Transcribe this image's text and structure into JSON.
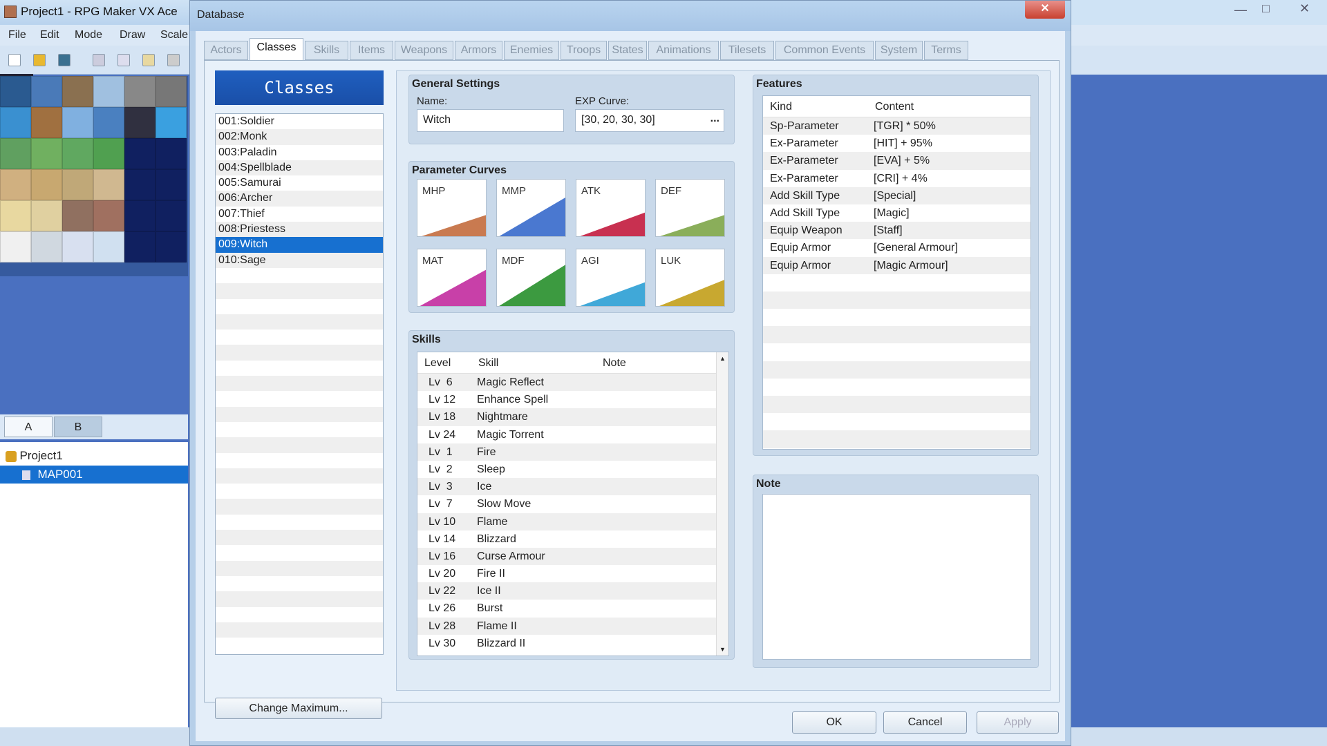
{
  "main_window": {
    "title": "Project1 - RPG Maker VX Ace",
    "menu": [
      "File",
      "Edit",
      "Mode",
      "Draw",
      "Scale"
    ],
    "layer_tabs": [
      "A",
      "B"
    ],
    "tree": {
      "project": "Project1",
      "map": "MAP001"
    }
  },
  "dialog": {
    "title": "Database",
    "tabs": [
      "Actors",
      "Classes",
      "Skills",
      "Items",
      "Weapons",
      "Armors",
      "Enemies",
      "Troops",
      "States",
      "Animations",
      "Tilesets",
      "Common Events",
      "System",
      "Terms"
    ],
    "active_tab": "Classes",
    "list_header": "Classes",
    "classes": [
      "001:Soldier",
      "002:Monk",
      "003:Paladin",
      "004:Spellblade",
      "005:Samurai",
      "006:Archer",
      "007:Thief",
      "008:Priestess",
      "009:Witch",
      "010:Sage"
    ],
    "selected_class": "009:Witch",
    "change_max": "Change Maximum...",
    "general": {
      "title": "General Settings",
      "name_label": "Name:",
      "name_value": "Witch",
      "exp_label": "EXP Curve:",
      "exp_value": "[30, 20, 30, 30]",
      "exp_button": "..."
    },
    "param_curves": {
      "title": "Parameter Curves",
      "items": [
        {
          "label": "MHP",
          "level": 0.45,
          "color": "#c97a50"
        },
        {
          "label": "MMP",
          "level": 0.8,
          "color": "#4a78d0"
        },
        {
          "label": "ATK",
          "level": 0.5,
          "color": "#c83050"
        },
        {
          "label": "DEF",
          "level": 0.45,
          "color": "#8aae5a"
        },
        {
          "label": "MAT",
          "level": 0.75,
          "color": "#c840a8"
        },
        {
          "label": "MDF",
          "level": 0.85,
          "color": "#3c9a40"
        },
        {
          "label": "AGI",
          "level": 0.5,
          "color": "#40a8d8"
        },
        {
          "label": "LUK",
          "level": 0.55,
          "color": "#c8a830"
        }
      ]
    },
    "skills": {
      "title": "Skills",
      "columns": [
        "Level",
        "Skill",
        "Note"
      ],
      "rows": [
        [
          "Lv  6",
          "Magic Reflect"
        ],
        [
          "Lv 12",
          "Enhance Spell"
        ],
        [
          "Lv 18",
          "Nightmare"
        ],
        [
          "Lv 24",
          "Magic Torrent"
        ],
        [
          "Lv  1",
          "Fire"
        ],
        [
          "Lv  2",
          "Sleep"
        ],
        [
          "Lv  3",
          "Ice"
        ],
        [
          "Lv  7",
          "Slow Move"
        ],
        [
          "Lv 10",
          "Flame"
        ],
        [
          "Lv 14",
          "Blizzard"
        ],
        [
          "Lv 16",
          "Curse Armour"
        ],
        [
          "Lv 20",
          "Fire II"
        ],
        [
          "Lv 22",
          "Ice II"
        ],
        [
          "Lv 26",
          "Burst"
        ],
        [
          "Lv 28",
          "Flame II"
        ],
        [
          "Lv 30",
          "Blizzard II"
        ]
      ]
    },
    "features": {
      "title": "Features",
      "columns": [
        "Kind",
        "Content"
      ],
      "rows": [
        [
          "Sp-Parameter",
          "[TGR] * 50%"
        ],
        [
          "Ex-Parameter",
          "[HIT] + 95%"
        ],
        [
          "Ex-Parameter",
          "[EVA] + 5%"
        ],
        [
          "Ex-Parameter",
          "[CRI] + 4%"
        ],
        [
          "Add Skill Type",
          "[Special]"
        ],
        [
          "Add Skill Type",
          "[Magic]"
        ],
        [
          "Equip Weapon",
          "[Staff]"
        ],
        [
          "Equip Armor",
          "[General Armour]"
        ],
        [
          "Equip Armor",
          "[Magic Armour]"
        ]
      ]
    },
    "note": {
      "title": "Note",
      "value": ""
    },
    "buttons": {
      "ok": "OK",
      "cancel": "Cancel",
      "apply": "Apply"
    }
  }
}
